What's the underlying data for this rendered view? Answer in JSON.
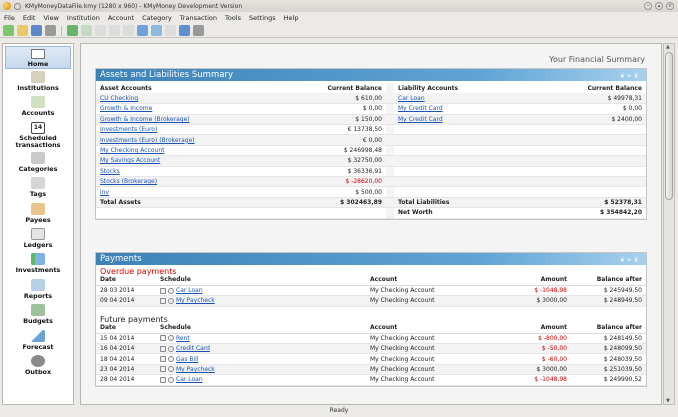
{
  "window": {
    "title": "KMyMoneyDataFile.kmy (1280 x 960) - KMyMoney Development Version"
  },
  "menu": [
    "File",
    "Edit",
    "View",
    "Institution",
    "Account",
    "Category",
    "Transaction",
    "Tools",
    "Settings",
    "Help"
  ],
  "sidebar": {
    "items": [
      {
        "label": "Home",
        "icon": "home-icon"
      },
      {
        "label": "Institutions",
        "icon": "bank-icon"
      },
      {
        "label": "Accounts",
        "icon": "accounts-icon"
      },
      {
        "label": "Scheduled transactions",
        "icon": "calendar-icon",
        "badge": "14"
      },
      {
        "label": "Categories",
        "icon": "pie-icon"
      },
      {
        "label": "Tags",
        "icon": "tag-icon"
      },
      {
        "label": "Payees",
        "icon": "people-icon"
      },
      {
        "label": "Ledgers",
        "icon": "ledger-icon"
      },
      {
        "label": "Investments",
        "icon": "chart-icon"
      },
      {
        "label": "Reports",
        "icon": "report-icon"
      },
      {
        "label": "Budgets",
        "icon": "budget-icon"
      },
      {
        "label": "Forecast",
        "icon": "forecast-icon"
      },
      {
        "label": "Outbox",
        "icon": "outbox-icon"
      }
    ]
  },
  "main": {
    "summary_title": "Your Financial Summary",
    "assets": {
      "title": "Assets and Liabilities Summary",
      "headers": {
        "asset_accounts": "Asset Accounts",
        "current_balance": "Current Balance",
        "liability_accounts": "Liability Accounts",
        "liability_balance": "Current Balance"
      },
      "asset_rows": [
        {
          "name": "CU Checking",
          "balance": "$ 610,00",
          "negative": false
        },
        {
          "name": "Growth & Income",
          "balance": "$ 0,00",
          "negative": false
        },
        {
          "name": "Growth & Income (Brokerage)",
          "balance": "$ 150,00",
          "negative": false
        },
        {
          "name": "Investments (Euro)",
          "balance": "€ 13738,50",
          "negative": false
        },
        {
          "name": "Investments (Euro) (Brokerage)",
          "balance": "€ 0,00",
          "negative": false
        },
        {
          "name": "My Checking Account",
          "balance": "$ 246998,48",
          "negative": false
        },
        {
          "name": "My Savings Account",
          "balance": "$ 32750,00",
          "negative": false
        },
        {
          "name": "Stocks",
          "balance": "$ 36336,91",
          "negative": false
        },
        {
          "name": "Stocks (Brokerage)",
          "balance": "$ -28620,00",
          "negative": true
        },
        {
          "name": "inv",
          "balance": "$ 500,00",
          "negative": false
        }
      ],
      "liability_rows": [
        {
          "name": "Car Loan",
          "balance": "$ 49978,31"
        },
        {
          "name": "My Credit Card",
          "balance": "$ 0,00"
        },
        {
          "name": "My Credit Card",
          "balance": "$ 2400,00"
        }
      ],
      "total_assets_label": "Total Assets",
      "total_assets": "$ 302463,89",
      "total_liabilities_label": "Total Liabilities",
      "total_liabilities": "$ 52378,31",
      "net_worth_label": "Net Worth",
      "net_worth": "$ 354842,20"
    },
    "payments": {
      "title": "Payments",
      "overdue_label": "Overdue payments",
      "future_label": "Future payments",
      "headers": {
        "date": "Date",
        "schedule": "Schedule",
        "account": "Account",
        "amount": "Amount",
        "balance_after": "Balance after"
      },
      "overdue": [
        {
          "date": "28 03 2014",
          "schedule": "Car Loan",
          "account": "My Checking Account",
          "amount": "$ -1048,98",
          "negative": true,
          "balance": "$ 245949,50"
        },
        {
          "date": "09 04 2014",
          "schedule": "My Paycheck",
          "account": "My Checking Account",
          "amount": "$ 3000,00",
          "negative": false,
          "balance": "$ 248949,50"
        }
      ],
      "future": [
        {
          "date": "15 04 2014",
          "schedule": "Rent",
          "account": "My Checking Account",
          "amount": "$ -800,00",
          "negative": true,
          "balance": "$ 248149,50"
        },
        {
          "date": "16 04 2014",
          "schedule": "Credit Card",
          "account": "My Checking Account",
          "amount": "$ -50,00",
          "negative": true,
          "balance": "$ 248099,50"
        },
        {
          "date": "18 04 2014",
          "schedule": "Gas Bill",
          "account": "My Checking Account",
          "amount": "$ -60,00",
          "negative": true,
          "balance": "$ 248039,50"
        },
        {
          "date": "23 04 2014",
          "schedule": "My Paycheck",
          "account": "My Checking Account",
          "amount": "$ 3000,00",
          "negative": false,
          "balance": "$ 251039,50"
        },
        {
          "date": "28 04 2014",
          "schedule": "Car Loan",
          "account": "My Checking Account",
          "amount": "$ -1048,98",
          "negative": true,
          "balance": "$ 249990,52"
        }
      ]
    }
  },
  "status": "Ready",
  "colors": {
    "panel_header": "#3d82b7",
    "negative": "#d00000",
    "link": "#1a55b3"
  }
}
